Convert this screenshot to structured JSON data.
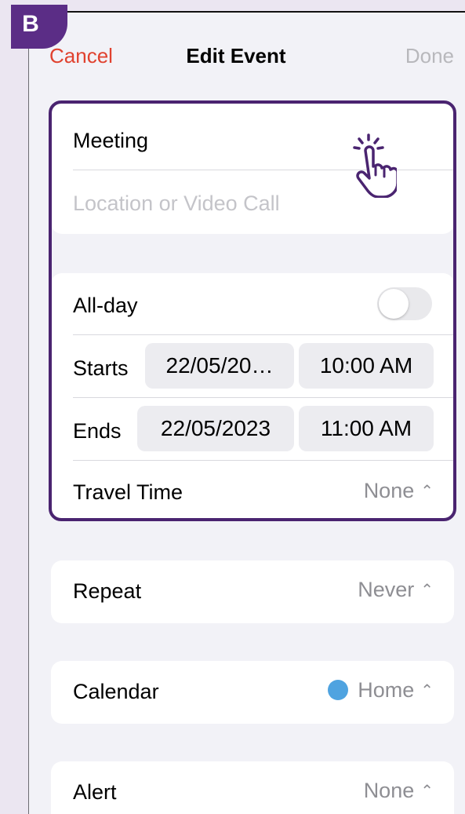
{
  "badge": {
    "letter": "B"
  },
  "header": {
    "cancel_label": "Cancel",
    "title": "Edit Event",
    "done_label": "Done"
  },
  "event": {
    "title_value": "Meeting",
    "location_placeholder": "Location or Video Call"
  },
  "schedule": {
    "allday_label": "All-day",
    "allday_on": false,
    "starts_label": "Starts",
    "starts_date": "22/05/20…",
    "starts_time": "10:00 AM",
    "ends_label": "Ends",
    "ends_date": "22/05/2023",
    "ends_time": "11:00 AM",
    "travel_label": "Travel Time",
    "travel_value": "None"
  },
  "repeat": {
    "label": "Repeat",
    "value": "Never"
  },
  "calendar": {
    "label": "Calendar",
    "value": "Home",
    "color": "#4fa3e0"
  },
  "alert": {
    "label": "Alert",
    "value": "None"
  },
  "colors": {
    "accent_cancel": "#e0422f",
    "highlight": "#4a2470",
    "badge": "#5b2d86"
  },
  "icons": {
    "tap": "tap-hand-icon",
    "chevron": "up-down-chevron-icon"
  }
}
